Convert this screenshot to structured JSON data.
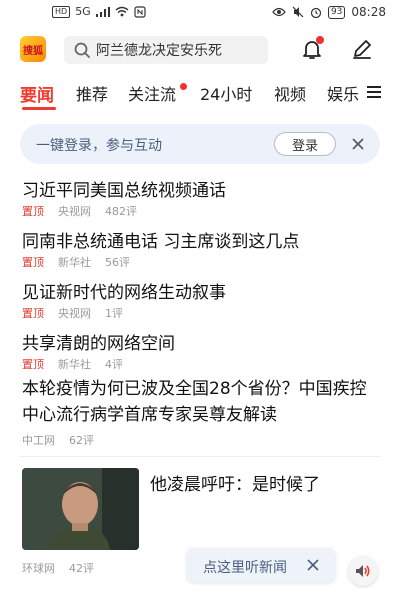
{
  "status_bar": {
    "network": "HD",
    "signal": "5G",
    "battery": "93",
    "time": "08:28"
  },
  "header": {
    "logo_text": "搜狐",
    "search_placeholder": "阿兰德龙决定安乐死"
  },
  "tabs": [
    {
      "label": "要闻",
      "active": true
    },
    {
      "label": "推荐"
    },
    {
      "label": "关注流"
    },
    {
      "label": "24小时"
    },
    {
      "label": "视频"
    },
    {
      "label": "娱乐"
    }
  ],
  "login_banner": {
    "text": "一键登录，参与互动",
    "button": "登录"
  },
  "news": [
    {
      "title": "习近平同美国总统视频通话",
      "pin": "置顶",
      "source": "央视网",
      "comments": "482评"
    },
    {
      "title": "同南非总统通电话 习主席谈到这几点",
      "pin": "置顶",
      "source": "新华社",
      "comments": "56评"
    },
    {
      "title": "见证新时代的网络生动叙事",
      "pin": "置顶",
      "source": "央视网",
      "comments": "1评"
    },
    {
      "title": "共享清朗的网络空间",
      "pin": "置顶",
      "source": "新华社",
      "comments": "4评"
    },
    {
      "title": "本轮疫情为何已波及全国28个省份？中国疾控中心流行病学首席专家吴尊友解读",
      "pin": "",
      "source": "中工网",
      "comments": "62评"
    }
  ],
  "image_story": {
    "title": "他凌晨呼吁：是时候了",
    "source": "环球网",
    "comments": "42评"
  },
  "listen_toast": {
    "text": "点这里听新闻"
  },
  "colors": {
    "accent": "#f03b2f",
    "banner_bg": "#edf1f9",
    "banner_text": "#4a5f80"
  }
}
